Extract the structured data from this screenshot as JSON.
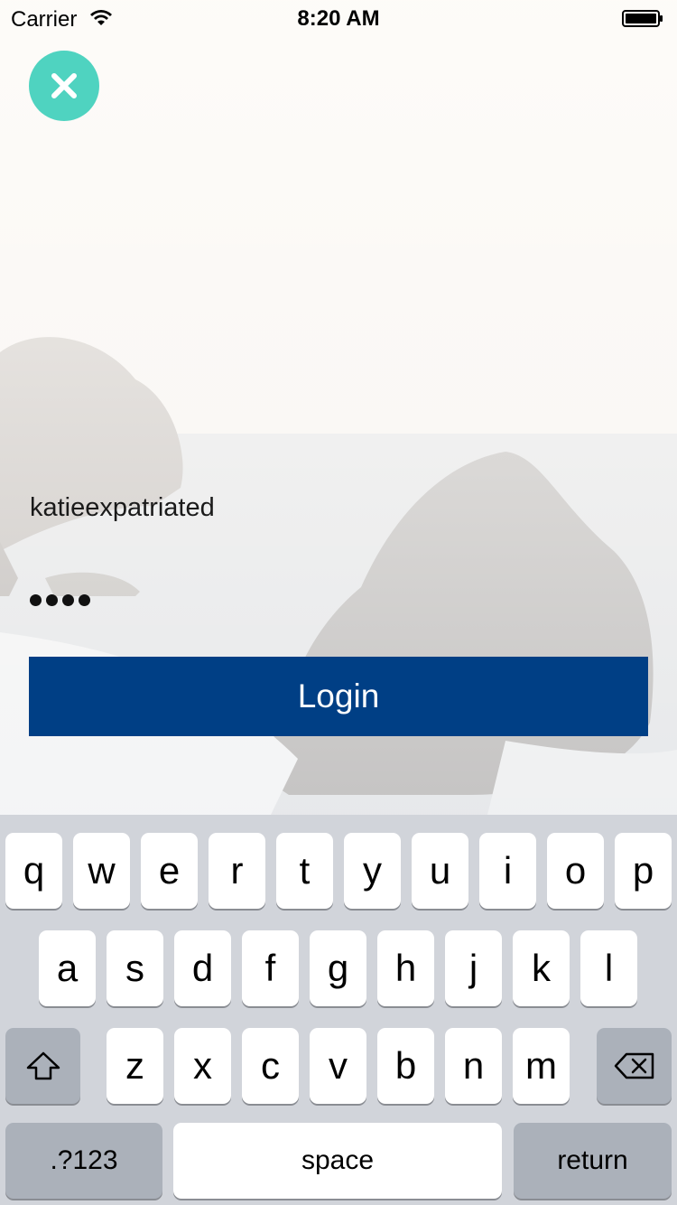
{
  "status_bar": {
    "carrier": "Carrier",
    "time": "8:20 AM"
  },
  "login": {
    "username_value": "katieexpatriated",
    "password_masked_count": 4,
    "login_label": "Login"
  },
  "colors": {
    "close_button": "#4fd3c0",
    "login_button": "#003f85",
    "keyboard_bg": "#d1d4da"
  },
  "icons": {
    "close": "close-icon",
    "shift": "shift-icon",
    "delete": "delete-icon",
    "wifi": "wifi-icon",
    "battery": "battery-icon"
  },
  "keyboard": {
    "row1": [
      "q",
      "w",
      "e",
      "r",
      "t",
      "y",
      "u",
      "i",
      "o",
      "p"
    ],
    "row2": [
      "a",
      "s",
      "d",
      "f",
      "g",
      "h",
      "j",
      "k",
      "l"
    ],
    "row3": [
      "z",
      "x",
      "c",
      "v",
      "b",
      "n",
      "m"
    ],
    "numbers_label": ".?123",
    "space_label": "space",
    "return_label": "return"
  }
}
